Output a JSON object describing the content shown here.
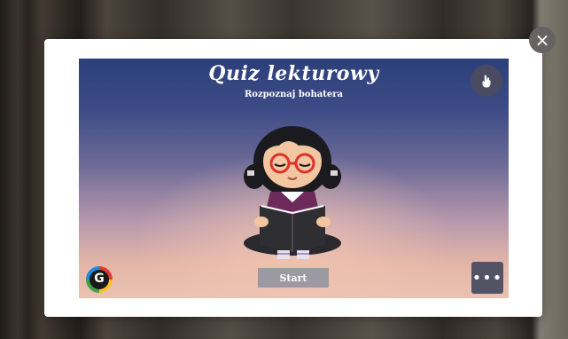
{
  "quiz": {
    "title": "Quiz lekturowy",
    "subtitle": "Rozpoznaj bohatera",
    "start_label": "Start",
    "more_label": "•••",
    "close_label": "×",
    "logo_letter": "G"
  },
  "icons": {
    "close": "close-icon",
    "touch": "hand-touch-icon",
    "more": "more-dots-icon",
    "logo": "genially-logo-icon"
  },
  "colors": {
    "modal": "#ffffff",
    "close_button": "#666362",
    "start_button": "#9b9aa3",
    "sky_top": "#2c3f7a",
    "sky_bottom": "#e9c2b3"
  }
}
